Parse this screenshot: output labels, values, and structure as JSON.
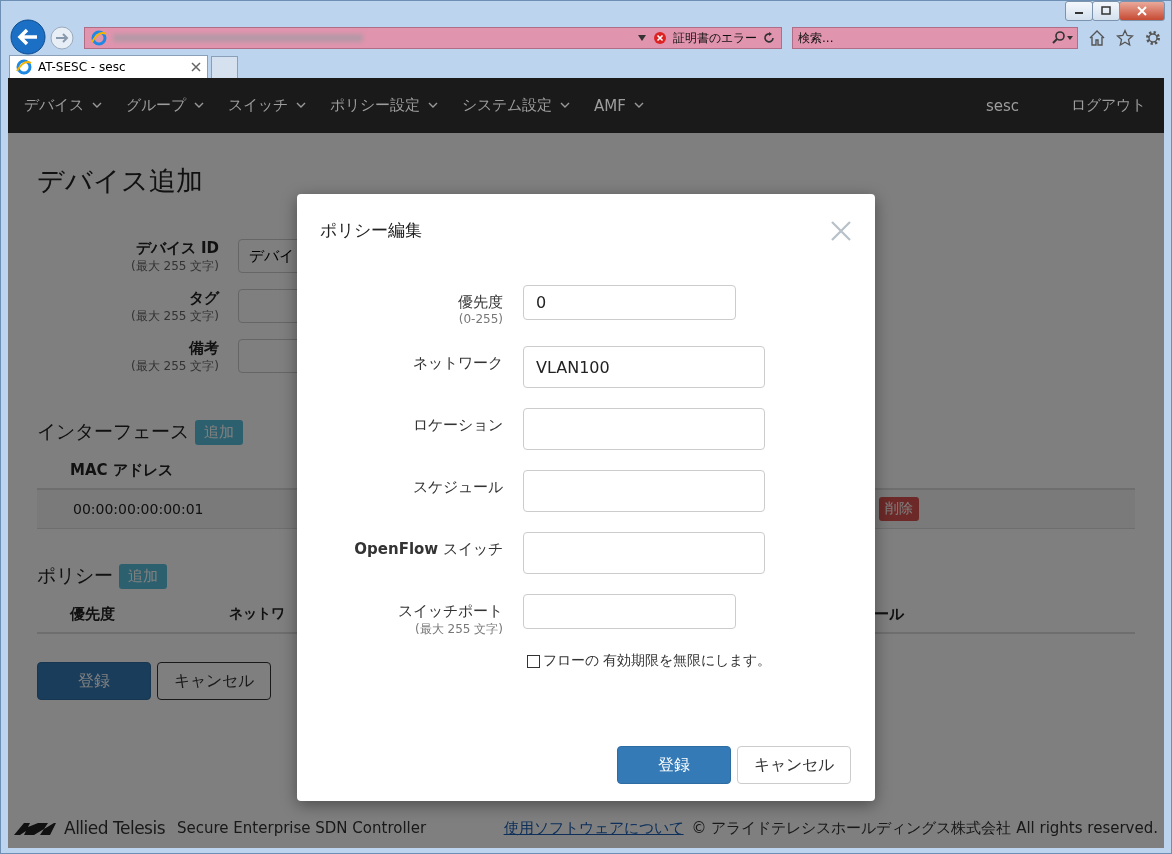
{
  "browser": {
    "cert_error": "証明書のエラー",
    "search_placeholder": "検索...",
    "tab_title": "AT-SESC - sesc"
  },
  "nav": {
    "items": [
      "デバイス",
      "グループ",
      "スイッチ",
      "ポリシー設定",
      "システム設定",
      "AMF"
    ],
    "user": "sesc",
    "logout": "ログアウト"
  },
  "page": {
    "title": "デバイス追加",
    "fields": [
      {
        "label": "デバイス ID",
        "hint": "(最大 255 文字)",
        "value": "デバイ"
      },
      {
        "label": "タグ",
        "hint": "(最大 255 文字)"
      },
      {
        "label": "備考",
        "hint": "(最大 255 文字)"
      }
    ],
    "interfaces": {
      "heading": "インターフェース",
      "add_button": "追加",
      "columns": [
        "MAC アドレス"
      ],
      "rows": [
        {
          "mac": "00:00:00:00:00:01",
          "delete_button": "削除"
        }
      ]
    },
    "policies": {
      "heading": "ポリシー",
      "add_button": "追加",
      "columns": [
        "優先度",
        "ネットワ",
        "ール"
      ]
    },
    "buttons": {
      "submit": "登録",
      "cancel": "キャンセル"
    }
  },
  "modal": {
    "title": "ポリシー編集",
    "fields": [
      {
        "label": "優先度",
        "hint": "(0-255)",
        "value": "0",
        "kind": "short"
      },
      {
        "label": "ネットワーク",
        "value": "VLAN100",
        "kind": "long"
      },
      {
        "label": "ロケーション",
        "kind": "long"
      },
      {
        "label": "スケジュール",
        "kind": "long"
      },
      {
        "label": "**OpenFlow** スイッチ",
        "kind": "long"
      },
      {
        "label": "スイッチポート",
        "hint": "(最大 255 文字)",
        "kind": "short"
      }
    ],
    "checkbox": {
      "label": "フローの 有効期限を無限にします。",
      "checked": false
    },
    "submit": "登録",
    "cancel": "キャンセル"
  },
  "footer": {
    "brand": "Allied Telesis",
    "product": "Secure Enterprise SDN Controller",
    "link": "使用ソフトウェアについて",
    "copyright": "© アライドテレシスホールディングス株式会社 All rights reserved."
  }
}
